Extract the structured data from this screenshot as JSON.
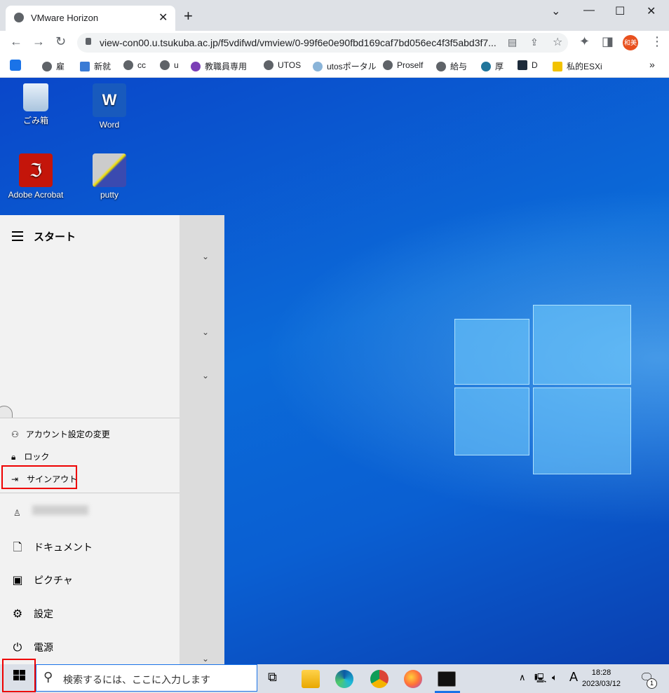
{
  "browser": {
    "tab_title": "VMware Horizon",
    "url": "view-con00.u.tsukuba.ac.jp/f5vdifwd/vmview/0-99f6e0e90fbd169caf7bd056ec4f3f5abd3f7...",
    "profile_label": "和美",
    "bookmarks": [
      "雇",
      "新就",
      "cc",
      "u",
      "教職員専用",
      "UTOS",
      "utosポータル",
      "Proself",
      "給与",
      "厚",
      "D",
      "私的ESXi"
    ],
    "more_bookmarks": "»"
  },
  "desktop": {
    "icons": [
      {
        "label": "ごみ箱",
        "icon": "recycle-bin-icon"
      },
      {
        "label": "Word",
        "icon": "word-icon"
      },
      {
        "label": "Adobe Acrobat",
        "icon": "acrobat-icon"
      },
      {
        "label": "putty",
        "icon": "putty-icon"
      }
    ]
  },
  "start_menu": {
    "title": "スタート",
    "account_menu": [
      "アカウント設定の変更",
      "ロック",
      "サインアウト"
    ],
    "items": [
      {
        "label": "ドキュメント",
        "icon": "document-icon"
      },
      {
        "label": "ピクチャ",
        "icon": "pictures-icon"
      },
      {
        "label": "設定",
        "icon": "settings-icon"
      },
      {
        "label": "電源",
        "icon": "power-icon"
      }
    ]
  },
  "taskbar": {
    "search_placeholder": "検索するには、ここに入力します",
    "time": "18:28",
    "date": "2023/03/12",
    "ime": "A",
    "notification_count": "1"
  }
}
